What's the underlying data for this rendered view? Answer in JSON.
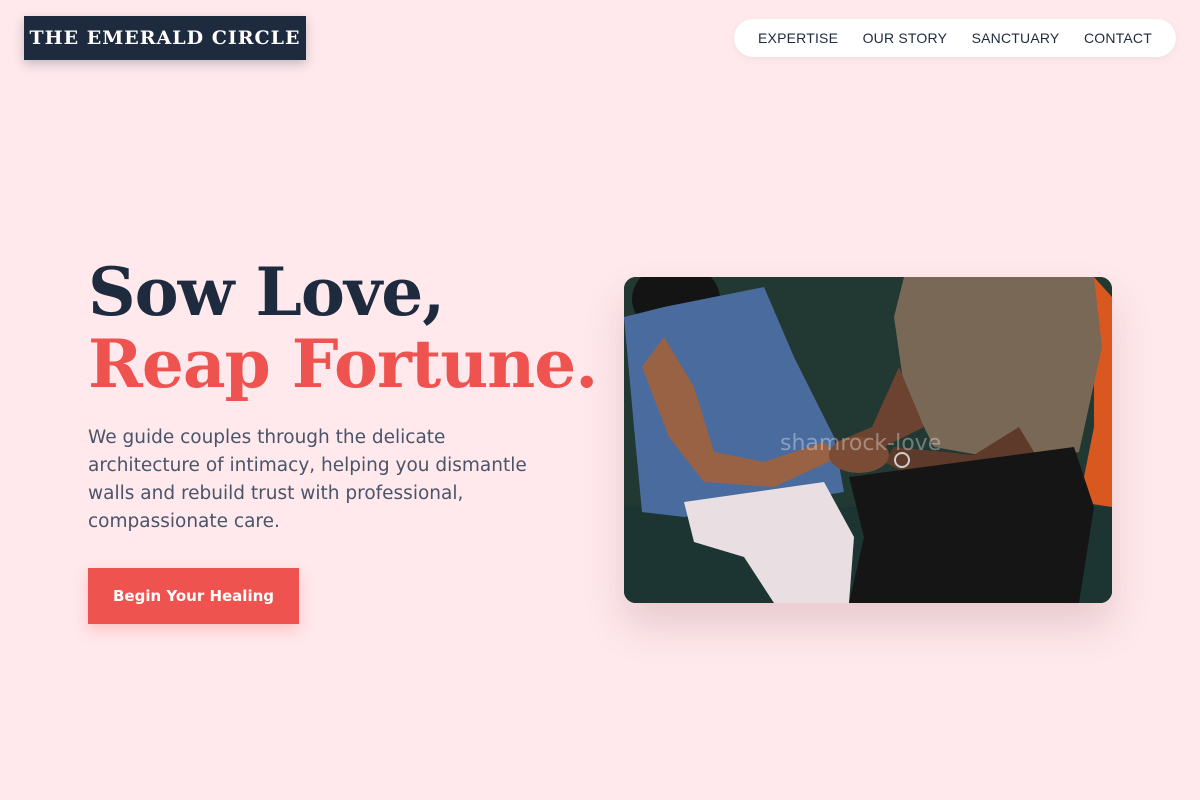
{
  "brand": {
    "name": "THE EMERALD CIRCLE"
  },
  "nav": {
    "items": [
      {
        "label": "EXPERTISE"
      },
      {
        "label": "OUR STORY"
      },
      {
        "label": "SANCTUARY"
      },
      {
        "label": "CONTACT"
      }
    ]
  },
  "hero": {
    "title_line1": "Sow Love,",
    "title_line2": "Reap Fortune.",
    "description": "We guide couples through the delicate architecture of intimacy, helping you dismantle walls and rebuild trust with professional, compassionate care.",
    "cta_label": "Begin Your Healing",
    "image": {
      "subject": "couple-holding-hands-photo",
      "watermark": "shamrock-love"
    }
  },
  "colors": {
    "background": "#ffe9ec",
    "navy": "#1e2a3e",
    "accent": "#ef5350",
    "body_text": "#4a5468"
  }
}
